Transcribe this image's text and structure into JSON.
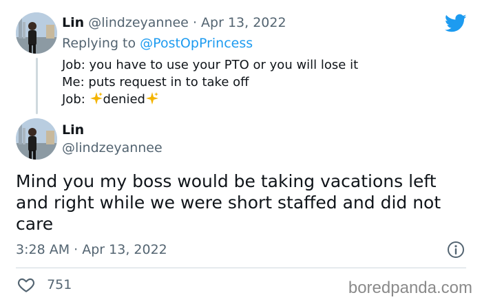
{
  "tweet1": {
    "name": "Lin",
    "handle": "@lindzeyannee",
    "separator": "·",
    "date": "Apr 13, 2022",
    "replying_prefix": "Replying to",
    "replying_to": "@PostOpPrincess",
    "lines": [
      "Job: you have to use your PTO or you will lose it",
      "Me: puts request in to take off"
    ],
    "job_label": "Job:",
    "job_word": "denied"
  },
  "tweet2": {
    "name": "Lin",
    "handle": "@lindzeyannee",
    "text": "Mind you my boss would be taking vacations left and right while we were short staffed and did not care",
    "time": "3:28 AM",
    "separator": "·",
    "date": "Apr 13, 2022",
    "likes": "751"
  },
  "watermark": "boredpanda.com",
  "colors": {
    "text": "#0f1419",
    "muted": "#536471",
    "accent": "#1d9bf0",
    "divider": "#cfd9de",
    "sparkle": "#f4b400"
  },
  "icons": {
    "brand": "twitter-bird-icon",
    "info": "info-icon",
    "like": "heart-icon",
    "emoji": "sparkles-icon"
  }
}
